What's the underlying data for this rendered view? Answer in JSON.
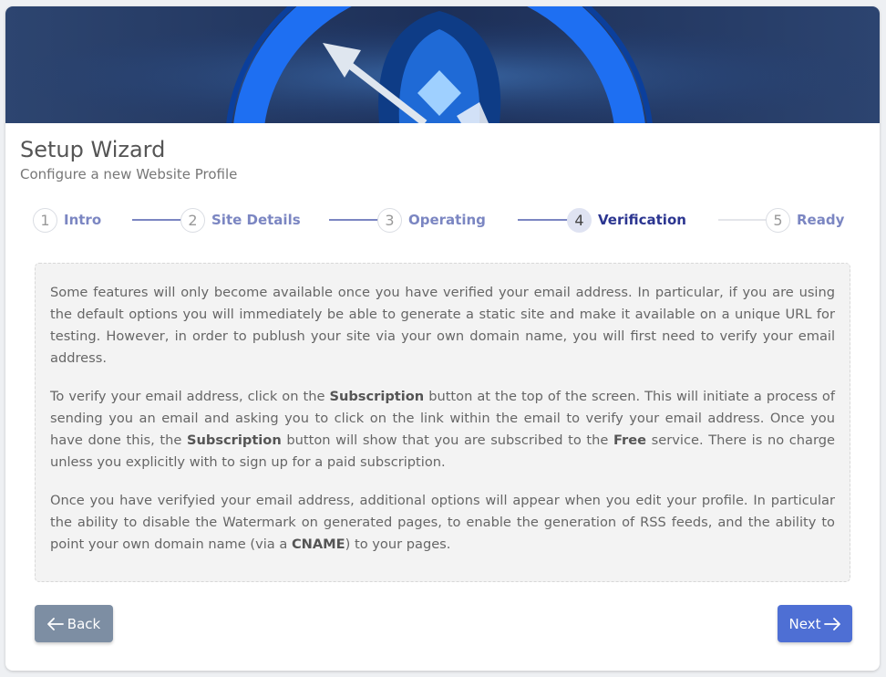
{
  "header": {
    "title": "Setup Wizard",
    "subtitle": "Configure a new Website Profile"
  },
  "steps": [
    {
      "num": "1",
      "label": "Intro"
    },
    {
      "num": "2",
      "label": "Site Details"
    },
    {
      "num": "3",
      "label": "Operating"
    },
    {
      "num": "4",
      "label": "Verification"
    },
    {
      "num": "5",
      "label": "Ready"
    }
  ],
  "active_step": 4,
  "content": {
    "p1": "Some features will only become available once you have verified your email address. In particular, if you are using the default options you will immediately be able to generate a static site and make it available on a unique URL for testing. However, in order to publush your site via your own domain name, you will first need to verify your email address.",
    "p2": {
      "a": "To verify your email address, click on the ",
      "b1": "Subscription",
      "c": " button at the top of the screen. This will initiate a process of sending you an email and asking you to click on the link within the email to verify your email address. Once you have done this, the ",
      "b2": "Subscription",
      "d": " button will show that you are subscribed to the ",
      "b3": "Free",
      "e": " service. There is no charge unless you explicitly with to sign up for a paid subscription."
    },
    "p3": {
      "a": "Once you have verifyied your email address, additional options will appear when you edit your profile. In particular the ability to disable the Watermark on generated pages, to enable the generation of RSS feeds, and the ability to point your own domain name (via a ",
      "b": "CNAME",
      "c": ") to your pages."
    }
  },
  "buttons": {
    "back": "Back",
    "next": "Next"
  },
  "colors": {
    "accent": "#4e6fd4",
    "step_label": "#7b86c2",
    "step_active": "#2b3590",
    "back_button": "#7d8ea3"
  }
}
